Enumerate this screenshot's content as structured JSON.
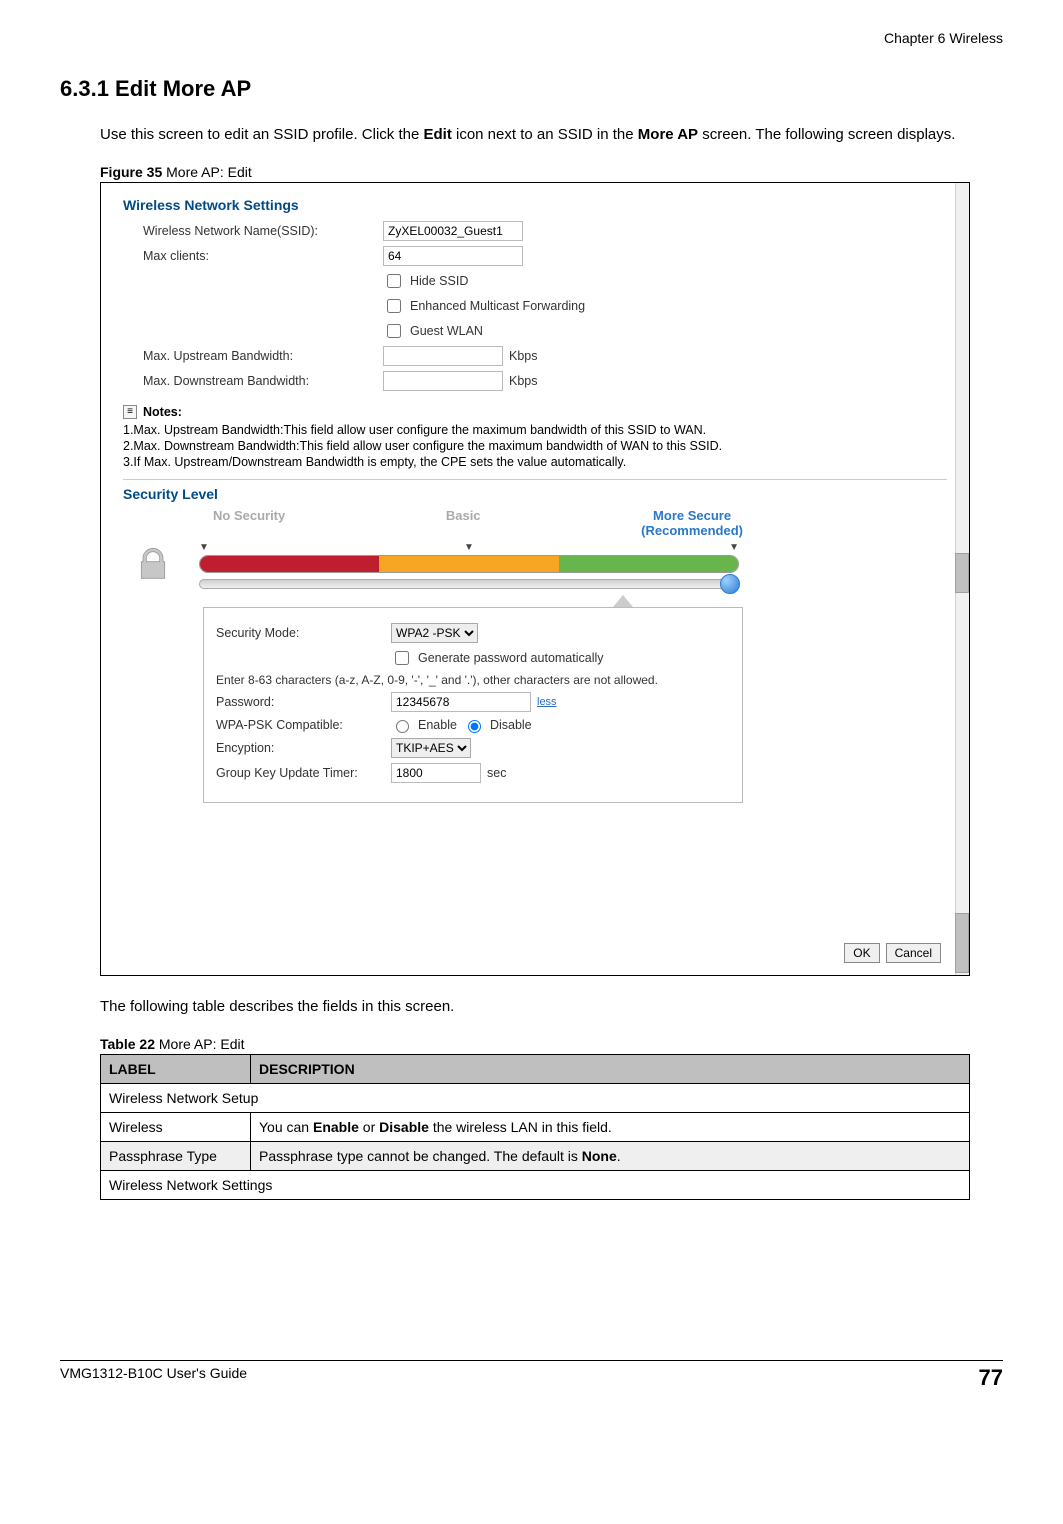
{
  "header": {
    "chapter": "Chapter 6 Wireless"
  },
  "section": {
    "number_title": "6.3.1  Edit More AP"
  },
  "intro": {
    "pre": "Use this screen to edit an SSID profile. Click the ",
    "bold1": "Edit",
    "mid": " icon next to an SSID in the ",
    "bold2": "More AP",
    "post": " screen. The following screen displays."
  },
  "figure": {
    "caption_label": "Figure 35",
    "caption_text": "   More AP: Edit",
    "wns_title": "Wireless Network Settings",
    "labels": {
      "ssid": "Wireless Network Name(SSID):",
      "max_clients": "Max clients:",
      "hide_ssid": "Hide SSID",
      "emf": "Enhanced Multicast Forwarding",
      "guest": "Guest WLAN",
      "up_bw": "Max. Upstream Bandwidth:",
      "down_bw": "Max. Downstream Bandwidth:",
      "kbps": "Kbps"
    },
    "values": {
      "ssid": "ZyXEL00032_Guest1",
      "max_clients": "64",
      "up_bw": "",
      "down_bw": ""
    },
    "notes": {
      "title": "Notes:",
      "items": [
        "1.Max. Upstream Bandwidth:This field allow user configure the maximum bandwidth of this SSID to WAN.",
        "2.Max. Downstream Bandwidth:This field allow user configure the maximum bandwidth of WAN to this SSID.",
        "3.If Max. Upstream/Downstream Bandwidth is empty, the CPE sets the value automatically."
      ]
    },
    "security": {
      "title": "Security Level",
      "levels": {
        "none": "No Security",
        "basic": "Basic",
        "more": "More Secure",
        "more_sub": "(Recommended)"
      },
      "panel": {
        "mode_label": "Security Mode:",
        "mode_value": "WPA2 -PSK",
        "gen_pwd": "Generate password automatically",
        "hint": "Enter 8-63 characters (a-z, A-Z, 0-9, '-', '_' and '.'), other characters are not allowed.",
        "pwd_label": "Password:",
        "pwd_value": "12345678",
        "less_link": "less",
        "wpa_compat_label": "WPA-PSK Compatible:",
        "enable": "Enable",
        "disable": "Disable",
        "enc_label": "Encyption:",
        "enc_value": "TKIP+AES",
        "gkt_label": "Group Key Update Timer:",
        "gkt_value": "1800",
        "sec_unit": "sec"
      }
    },
    "buttons": {
      "ok": "OK",
      "cancel": "Cancel"
    }
  },
  "after_figure": "The following table describes the fields in this screen.",
  "table": {
    "caption_label": "Table 22",
    "caption_text": "   More AP: Edit",
    "head": {
      "label": "LABEL",
      "desc": "DESCRIPTION"
    },
    "rows": {
      "r1_span": "Wireless Network Setup",
      "r2_label": "Wireless",
      "r2_pre": "You can ",
      "r2_b1": "Enable",
      "r2_mid": " or ",
      "r2_b2": "Disable",
      "r2_post": " the wireless LAN in this field.",
      "r3_label": "Passphrase Type",
      "r3_pre": "Passphrase type cannot be changed. The default is ",
      "r3_b": "None",
      "r3_post": ".",
      "r4_span": "Wireless Network Settings"
    }
  },
  "footer": {
    "guide": "VMG1312-B10C User's Guide",
    "page": "77"
  }
}
